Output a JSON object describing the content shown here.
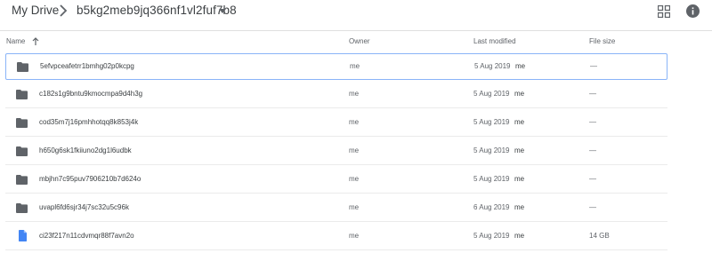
{
  "breadcrumb": {
    "root": "My Drive",
    "current": "b5kg2meb9jq366nf1vl2fuf7b8"
  },
  "columns": {
    "name": "Name",
    "owner": "Owner",
    "modified": "Last modified",
    "size": "File size"
  },
  "icons": {
    "sort": "arrow-up-icon",
    "grid": "grid-view-icon",
    "info": "info-icon",
    "folder": "folder-icon",
    "file": "document-icon"
  },
  "colors": {
    "folder": "#5f6368",
    "file": "#4285f4",
    "selected_border": "#8ab4f8"
  },
  "rows": [
    {
      "type": "folder",
      "name": "5efvpceafetrr1bmhg02p0kcpg",
      "owner": "me",
      "modified": "5 Aug 2019",
      "modified_by": "me",
      "size": "—",
      "selected": true
    },
    {
      "type": "folder",
      "name": "c182s1g9bntu9kmocmpa9d4h3g",
      "owner": "me",
      "modified": "5 Aug 2019",
      "modified_by": "me",
      "size": "—"
    },
    {
      "type": "folder",
      "name": "cod35m7j16pmhhotqq8k853j4k",
      "owner": "me",
      "modified": "5 Aug 2019",
      "modified_by": "me",
      "size": "—"
    },
    {
      "type": "folder",
      "name": "h650g6sk1fkiiuno2dg1l6udbk",
      "owner": "me",
      "modified": "5 Aug 2019",
      "modified_by": "me",
      "size": "—"
    },
    {
      "type": "folder",
      "name": "mbjhn7c95puv7906210b7d624o",
      "owner": "me",
      "modified": "5 Aug 2019",
      "modified_by": "me",
      "size": "—"
    },
    {
      "type": "folder",
      "name": "uvapl6fd6sjr34j7sc32u5c96k",
      "owner": "me",
      "modified": "6 Aug 2019",
      "modified_by": "me",
      "size": "—"
    },
    {
      "type": "file",
      "name": "ci23f217n11cdvmqr88f7avn2o",
      "owner": "me",
      "modified": "5 Aug 2019",
      "modified_by": "me",
      "size": "14 GB"
    }
  ]
}
